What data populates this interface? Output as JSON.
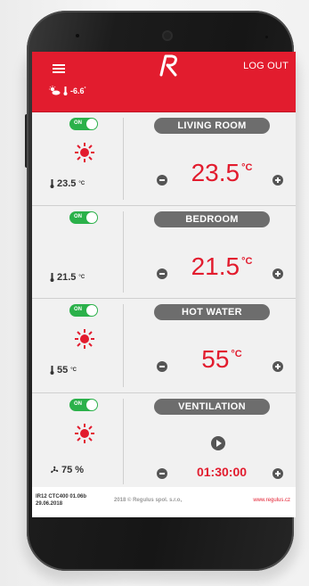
{
  "header": {
    "logo_text": "R",
    "logout_label": "LOG OUT",
    "outdoor_temp": "-6.6",
    "outdoor_unit": "°"
  },
  "zones": [
    {
      "title": "LIVING ROOM",
      "toggle": "ON",
      "mode": "sun",
      "reading": "23.5",
      "reading_unit": "°C",
      "setpoint": "23.5",
      "setpoint_unit": "°C"
    },
    {
      "title": "BEDROOM",
      "toggle": "ON",
      "mode": "moon",
      "reading": "21.5",
      "reading_unit": "°C",
      "setpoint": "21.5",
      "setpoint_unit": "°C"
    },
    {
      "title": "HOT WATER",
      "toggle": "ON",
      "mode": "sun",
      "reading": "55",
      "reading_unit": "°C",
      "setpoint": "55",
      "setpoint_unit": "°C"
    },
    {
      "title": "VENTILATION",
      "toggle": "ON",
      "mode": "sun",
      "reading": "75 %",
      "timer": "01:30:00"
    }
  ],
  "footer": {
    "firmware_line1": "IR12 CTC400 01.06b",
    "firmware_line2": "29.06.2018",
    "copyright": "2018 © Regulus spol. s.r.o,",
    "url": "www.regulus.cz"
  },
  "colors": {
    "accent": "#e21c2e",
    "toggle_on": "#2bb14a",
    "pill": "#6d6d6d"
  }
}
